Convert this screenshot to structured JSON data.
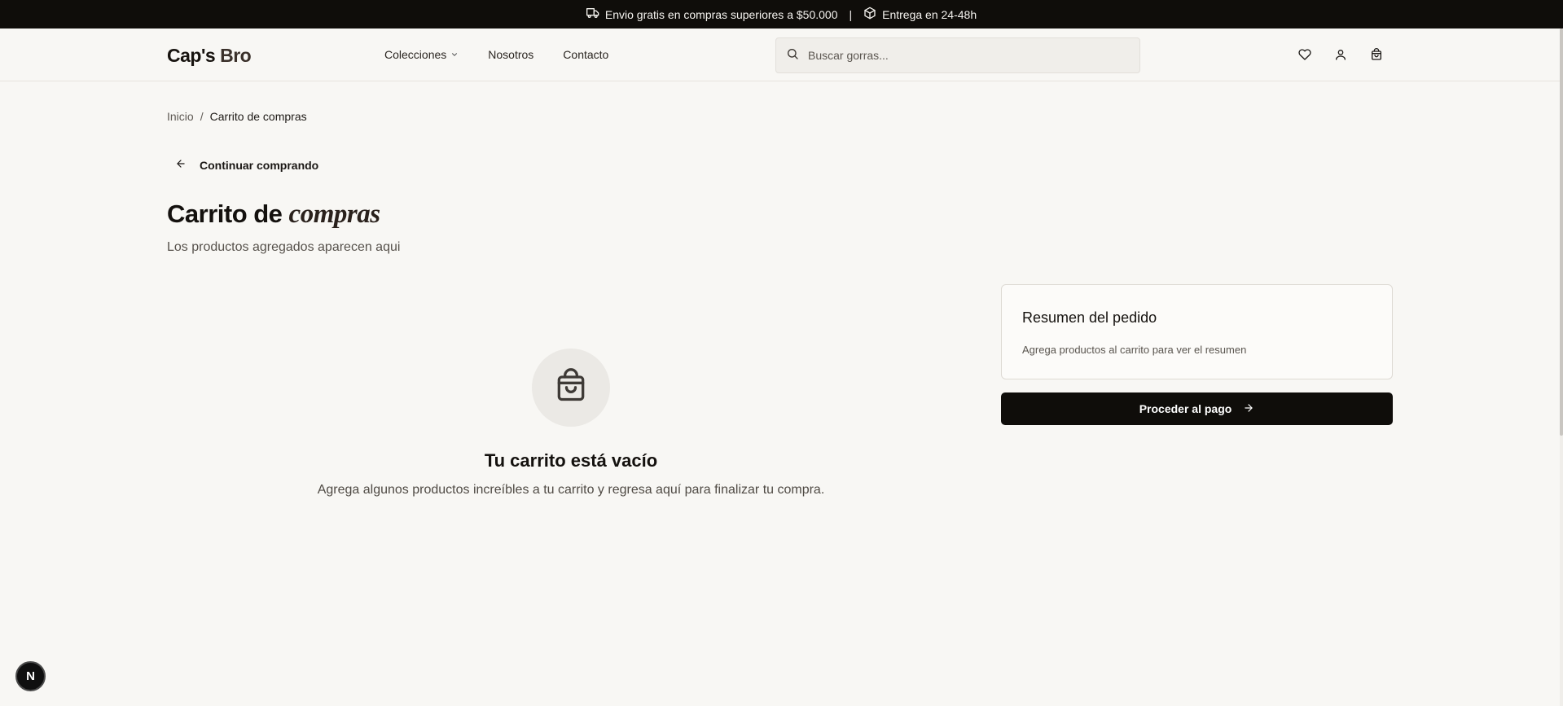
{
  "topbar": {
    "shipping": "Envio gratis en compras superiores a $50.000",
    "separator": "|",
    "delivery": "Entrega en 24-48h",
    "shipping_icon": "truck-icon",
    "delivery_icon": "package-icon"
  },
  "header": {
    "logo_main": "Cap's",
    "logo_accent": "Bro",
    "nav": {
      "collections": "Colecciones",
      "about": "Nosotros",
      "contact": "Contacto"
    },
    "search_placeholder": "Buscar gorras...",
    "icons": [
      "heart-icon",
      "user-icon",
      "shopping-bag-icon"
    ]
  },
  "breadcrumb": {
    "home": "Inicio",
    "separator": "/",
    "current": "Carrito de compras"
  },
  "page": {
    "back_label": "Continuar comprando",
    "title_main": "Carrito de",
    "title_accent": "compras",
    "subtitle": "Los productos agregados aparecen aqui"
  },
  "empty_cart": {
    "icon": "shopping-bag-icon",
    "title": "Tu carrito está vacío",
    "text": "Agrega algunos productos increíbles a tu carrito y regresa aquí para finalizar tu compra."
  },
  "summary": {
    "title": "Resumen del pedido",
    "text": "Agrega productos al carrito para ver el resumen",
    "checkout_label": "Proceder al pago"
  },
  "dev_badge": "N",
  "colors": {
    "background": "#f8f7f4",
    "topbar": "#0f0d0a",
    "button": "#0f0d0a",
    "accent_text": "#2a211c"
  }
}
